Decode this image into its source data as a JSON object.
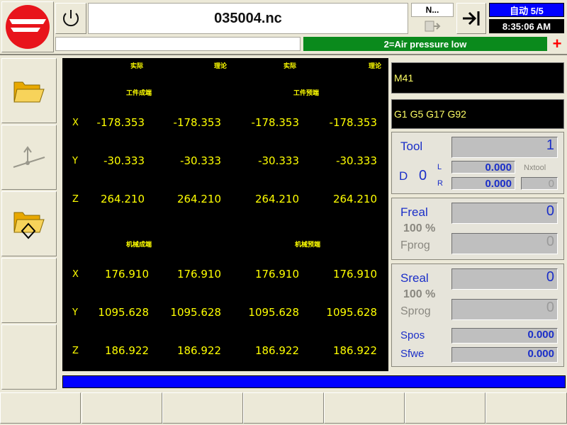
{
  "header": {
    "program_name": "035004.nc",
    "n_indicator": "N...",
    "mode": "自动 5/5",
    "time": "8:35:06 AM",
    "alarm_message": "2=Air pressure low",
    "alarm_icon": "red-cross-icon"
  },
  "sidebar": {
    "items": [
      {
        "icon": "folder-icon"
      },
      {
        "icon": "axis-arrow-icon"
      },
      {
        "icon": "folder-diamond-icon"
      },
      {
        "icon": ""
      },
      {
        "icon": ""
      }
    ]
  },
  "position": {
    "col_headers": [
      "实际",
      "理论",
      "实际",
      "理论"
    ],
    "workpiece_groups": [
      "工件成端",
      "工件预端"
    ],
    "machine_groups": [
      "机械成端",
      "机械预端"
    ],
    "workpiece_rows": [
      {
        "axis": "X",
        "values": [
          "-178.353",
          "-178.353",
          "-178.353",
          "-178.353"
        ]
      },
      {
        "axis": "Y",
        "values": [
          "-30.333",
          "-30.333",
          "-30.333",
          "-30.333"
        ]
      },
      {
        "axis": "Z",
        "values": [
          "264.210",
          "264.210",
          "264.210",
          "264.210"
        ]
      }
    ],
    "machine_rows": [
      {
        "axis": "X",
        "values": [
          "176.910",
          "176.910",
          "176.910",
          "176.910"
        ]
      },
      {
        "axis": "Y",
        "values": [
          "1095.628",
          "1095.628",
          "1095.628",
          "1095.628"
        ]
      },
      {
        "axis": "Z",
        "values": [
          "186.922",
          "186.922",
          "186.922",
          "186.922"
        ]
      }
    ]
  },
  "right_panel": {
    "m_code": "M41",
    "g_codes": "G1 G5 G17 G92",
    "tool": {
      "label": "Tool",
      "value": "1",
      "d_label": "D",
      "d_value": "0",
      "l_label": "L",
      "l_value": "0.000",
      "r_label": "R",
      "r_value": "0.000",
      "nxtool_label": "Nxtool",
      "nxtool_value": "0"
    },
    "feed": {
      "freal_label": "Freal",
      "freal_value": "0",
      "override": "100 %",
      "fprog_label": "Fprog",
      "fprog_value": "0"
    },
    "spindle": {
      "sreal_label": "Sreal",
      "sreal_value": "0",
      "override": "100 %",
      "sprog_label": "Sprog",
      "sprog_value": "0",
      "spos_label": "Spos",
      "spos_value": "0.000",
      "sfwe_label": "Sfwe",
      "sfwe_value": "0.000"
    }
  },
  "softkeys": [
    "",
    "",
    "",
    "",
    "",
    "",
    ""
  ],
  "colors": {
    "panel_bg": "#000000",
    "value_yellow": "#ffff00",
    "mode_blue": "#0000ff",
    "alarm_green": "#0a8a1c",
    "label_blue": "#1a2ec8"
  }
}
